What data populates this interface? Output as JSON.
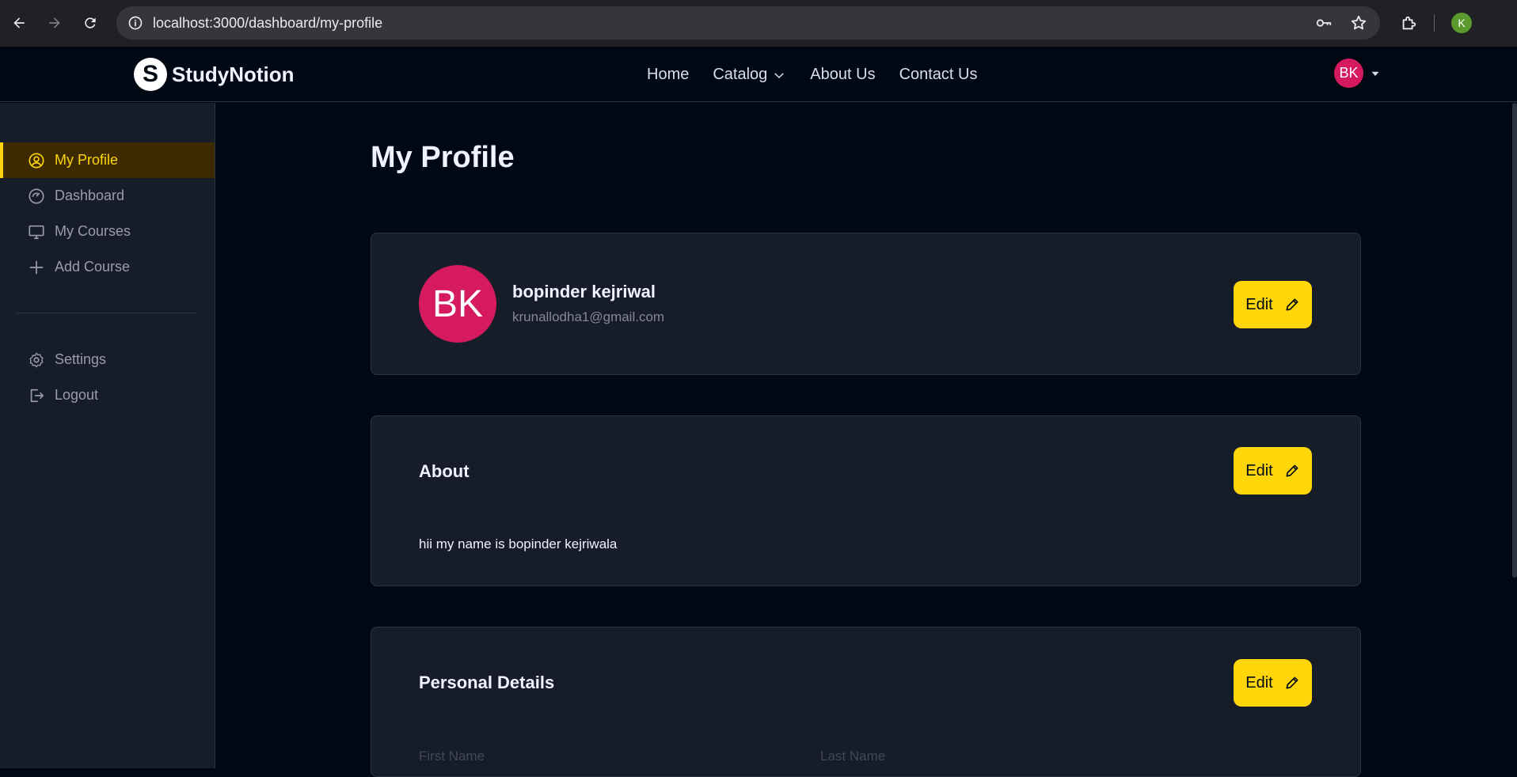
{
  "browser": {
    "url": "localhost:3000/dashboard/my-profile",
    "profile_initial": "K"
  },
  "nav": {
    "brand": "StudyNotion",
    "brand_mark": "S",
    "links": [
      "Home",
      "Catalog",
      "About Us",
      "Contact Us"
    ],
    "user_initials": "BK"
  },
  "sidebar": {
    "items": [
      {
        "label": "My Profile",
        "icon": "user-circle-icon"
      },
      {
        "label": "Dashboard",
        "icon": "gauge-icon"
      },
      {
        "label": "My Courses",
        "icon": "monitor-icon"
      },
      {
        "label": "Add Course",
        "icon": "plus-icon"
      },
      {
        "label": "Settings",
        "icon": "gear-icon"
      },
      {
        "label": "Logout",
        "icon": "logout-icon"
      }
    ]
  },
  "main": {
    "title": "My Profile",
    "profile": {
      "initials": "BK",
      "name": "bopinder kejriwal",
      "email": "krunallodha1@gmail.com",
      "edit_label": "Edit"
    },
    "about": {
      "heading": "About",
      "text": "hii my name is bopinder kejriwala",
      "edit_label": "Edit"
    },
    "personal": {
      "heading": "Personal Details",
      "edit_label": "Edit",
      "first_name_label": "First Name",
      "last_name_label": "Last Name"
    }
  },
  "colors": {
    "accent": "#ffd60a",
    "avatar": "#d61a5f",
    "background": "#000814",
    "card": "#161d29"
  }
}
